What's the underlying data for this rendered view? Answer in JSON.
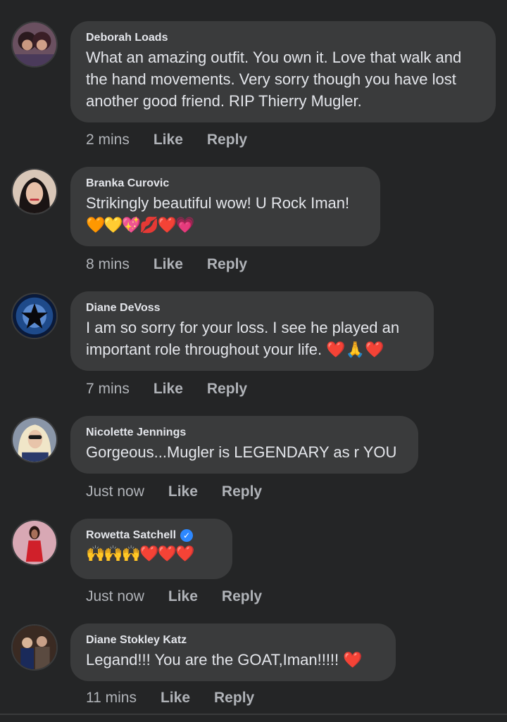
{
  "actions": {
    "like": "Like",
    "reply": "Reply"
  },
  "colors": {
    "background": "#242526",
    "bubble": "#3a3b3c",
    "verified": "#2d88ff"
  },
  "comments": [
    {
      "name": "Deborah Loads",
      "text": "What an amazing outfit. You own it. Love that walk and the hand movements. Very sorry though you have lost another good friend. RIP Thierry Mugler.",
      "time": "2 mins"
    },
    {
      "name": "Branka Curovic",
      "text": "Strikingly beautiful wow! U Rock Iman!",
      "emojis": "🧡💛💖💋❤️💗",
      "time": "8 mins"
    },
    {
      "name": "Diane DeVoss",
      "text": "I am so sorry for your loss. I see he played an important role throughout your life. ❤️🙏❤️",
      "time": "7 mins"
    },
    {
      "name": "Nicolette Jennings",
      "text": "Gorgeous...Mugler is LEGENDARY as r YOU",
      "time": "Just now"
    },
    {
      "name": "Rowetta Satchell",
      "verified": true,
      "emojis": "🙌🙌🙌❤️❤️❤️",
      "time": "Just now"
    },
    {
      "name": "Diane Stokley Katz",
      "text": "Legand!!! You are the GOAT,Iman!!!!!  ❤️",
      "time": "11 mins"
    }
  ]
}
